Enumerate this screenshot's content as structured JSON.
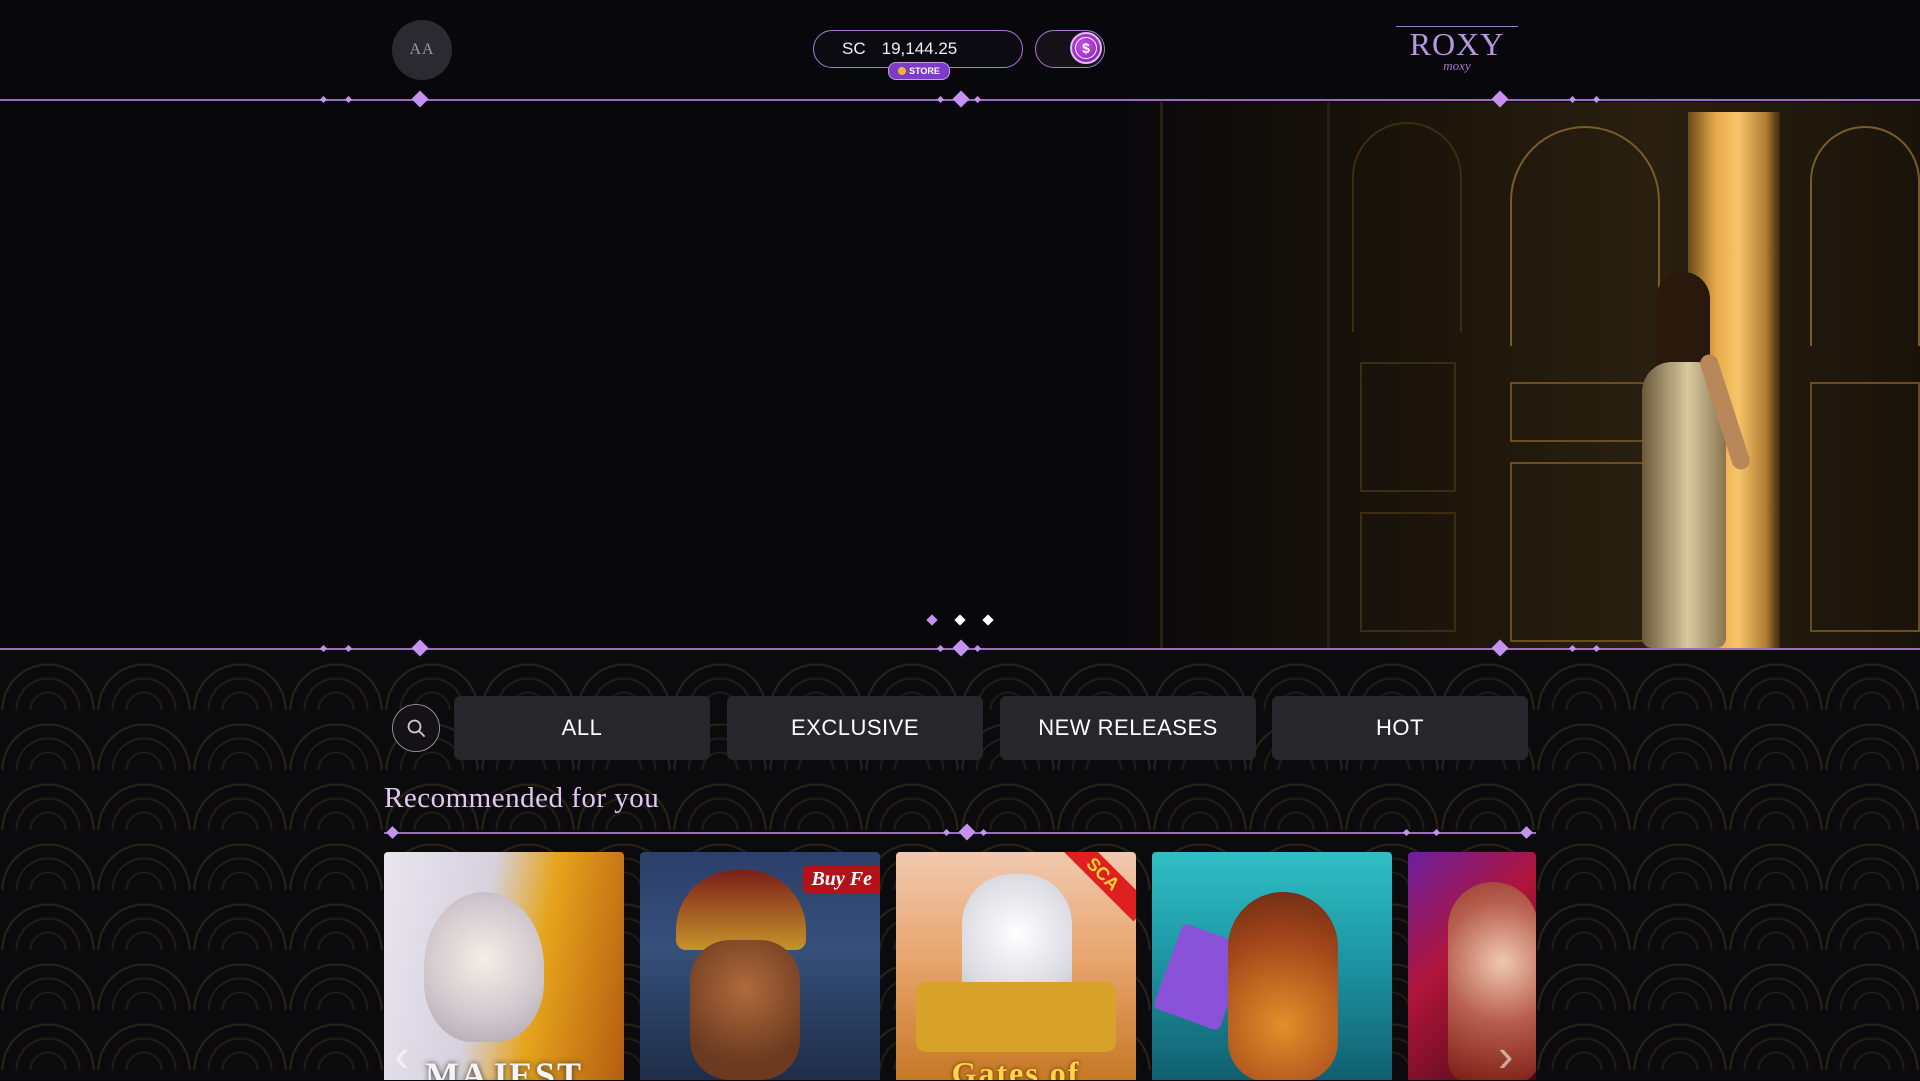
{
  "header": {
    "avatar_initials": "AA",
    "balance": {
      "currency": "SC",
      "amount": "19,144.25"
    },
    "store_label": "STORE",
    "logo": {
      "main": "ROXY",
      "sub": "moxy"
    }
  },
  "hero": {
    "slides_count": 3,
    "active_slide": 1
  },
  "filters": {
    "tabs": [
      "ALL",
      "EXCLUSIVE",
      "NEW RELEASES",
      "HOT"
    ]
  },
  "recommended": {
    "title": "Recommended for you",
    "games": [
      {
        "name": "Majestic lion slot",
        "title_text": "MAJEST"
      },
      {
        "name": "Old wizard slot",
        "badge": "Buy Fe"
      },
      {
        "name": "Gates of Olympus style slot",
        "title_text": "Gates of",
        "badge": "SCA"
      },
      {
        "name": "Owl slot"
      },
      {
        "name": "Red haired woman slot"
      }
    ]
  },
  "colors": {
    "accent": "#9b6cc6",
    "background": "#08070b",
    "tab_bg": "#27262b",
    "title_color": "#e0c9f2"
  }
}
